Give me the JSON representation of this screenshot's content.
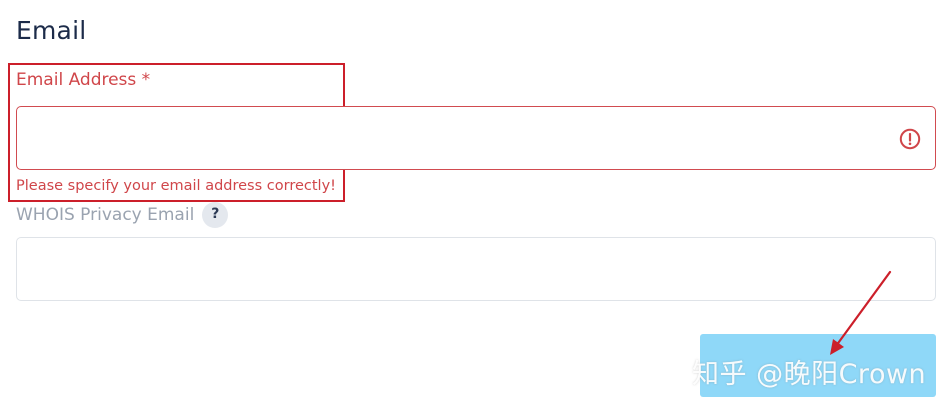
{
  "section": {
    "title": "Email"
  },
  "email_field": {
    "label": "Email Address *",
    "value": "",
    "placeholder": "",
    "error_message": "Please specify your email address correctly!"
  },
  "whois_field": {
    "label": "WHOIS Privacy Email",
    "help_badge": "?",
    "value": "",
    "placeholder": ""
  },
  "watermark": {
    "text": "知乎 @晚阳Crown"
  },
  "colors": {
    "title": "#1c2b49",
    "error": "#d0464a",
    "highlight_border": "#cc1f2a",
    "muted_label": "#9aa3b0",
    "input_border": "#dfe3e8",
    "submit_button": "#8fd8f8",
    "annotation_arrow": "#cc1f2a"
  },
  "icons": {
    "error": "exclamation-circle-icon",
    "help": "question-mark-icon",
    "annotation": "arrow-icon"
  }
}
